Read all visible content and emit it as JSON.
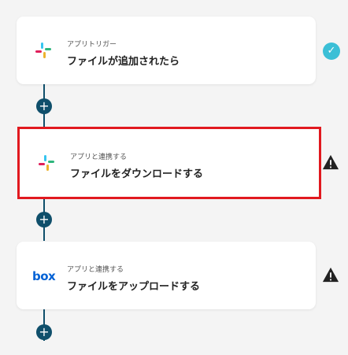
{
  "steps": [
    {
      "label": "アプリトリガー",
      "title": "ファイルが追加されたら",
      "app": "slack-icon"
    },
    {
      "label": "アプリと連携する",
      "title": "ファイルをダウンロードする",
      "app": "slack-icon"
    },
    {
      "label": "アプリと連携する",
      "title": "ファイルをアップロードする",
      "app": "box-icon"
    }
  ],
  "box_logo_text": "box",
  "colors": {
    "connector": "#0f4f6b",
    "check": "#3bbfd6",
    "highlight": "#e1191f",
    "box": "#0061d5"
  }
}
